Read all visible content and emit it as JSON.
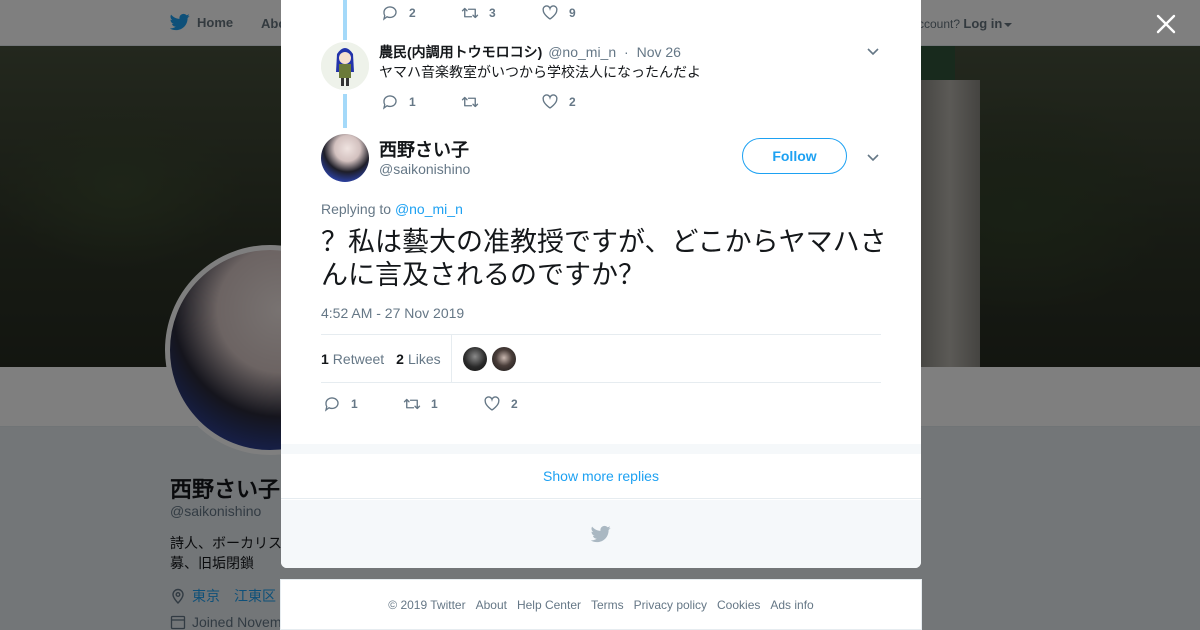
{
  "topbar": {
    "home_label": "Home",
    "about_label": "Abo",
    "account_prompt": "ccount?",
    "login_label": "Log in"
  },
  "profile": {
    "name": "西野さい子",
    "handle": "@saikonishino",
    "bio_line1": "詩人、ボーカリス",
    "bio_line2": "募、旧垢閉鎖",
    "location_1": "東京",
    "location_2": "江東区",
    "joined": "Joined Novem"
  },
  "prev_tweet": {
    "reply_count": "2",
    "retweet_count": "3",
    "like_count": "9"
  },
  "reply_tweet": {
    "author_name": "農民(内調用トウモロコシ)",
    "author_handle": "@no_mi_n",
    "separator": "·",
    "date": "Nov 26",
    "text": "ヤマハ音楽教室がいつから学校法人になったんだよ",
    "reply_count": "1",
    "retweet_count": "",
    "like_count": "2"
  },
  "main_tweet": {
    "author_name": "西野さい子",
    "author_handle": "@saikonishino",
    "follow_label": "Follow",
    "replying_prefix": "Replying to",
    "replying_handle": "@no_mi_n",
    "text": "？私は藝大の准教授ですが、どこからヤマハさんに言及されるのですか？",
    "timestamp": "4:52 AM - 27 Nov 2019",
    "retweets_num": "1",
    "retweets_label": "Retweet",
    "likes_num": "2",
    "likes_label": "Likes",
    "reply_count": "1",
    "retweet_count": "1",
    "like_count": "2"
  },
  "show_more_label": "Show more replies",
  "footer": {
    "copyright": "© 2019 Twitter",
    "links": [
      "About",
      "Help Center",
      "Terms",
      "Privacy policy",
      "Cookies",
      "Ads info"
    ]
  },
  "colors": {
    "accent": "#1da1f2",
    "thread_line": "#a4d9f9",
    "text_secondary": "#657786"
  },
  "icons": {
    "brand": "twitter-bird-icon",
    "close": "close-icon",
    "reply": "reply-icon",
    "retweet": "retweet-icon",
    "like": "heart-icon",
    "more": "chevron-down-icon",
    "location": "location-pin-icon",
    "calendar": "calendar-icon"
  }
}
